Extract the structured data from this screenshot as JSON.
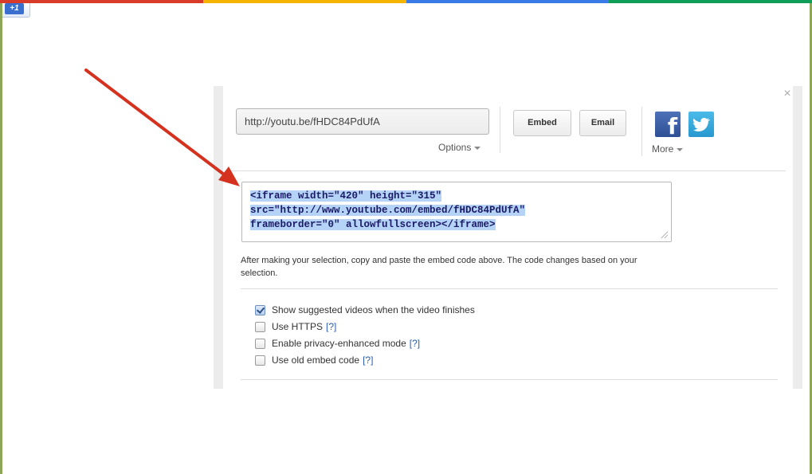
{
  "share": {
    "url_value": "http://youtu.be/fHDC84PdUfA",
    "options_label": "Options",
    "embed_label": "Embed",
    "email_label": "Email",
    "more_label": "More",
    "close_symbol": "×",
    "social": [
      {
        "name": "facebook",
        "glyph": "f"
      },
      {
        "name": "twitter",
        "glyph": ""
      },
      {
        "name": "google-plus-one",
        "glyph": "+1"
      }
    ]
  },
  "embed": {
    "code_lines": [
      "<iframe width=\"420\" height=\"315\"",
      "src=\"http://www.youtube.com/embed/fHDC84PdUfA\"",
      "frameborder=\"0\" allowfullscreen></iframe>"
    ],
    "help_text": "After making your selection, copy and paste the embed code above. The code changes based on your selection."
  },
  "options": [
    {
      "label": "Show suggested videos when the video finishes",
      "checked": true,
      "help": ""
    },
    {
      "label": "Use HTTPS",
      "checked": false,
      "help": "[?]"
    },
    {
      "label": "Enable privacy-enhanced mode",
      "checked": false,
      "help": "[?]"
    },
    {
      "label": "Use old embed code",
      "checked": false,
      "help": "[?]"
    }
  ],
  "colors": {
    "frame_border": "#8da556",
    "annotation_arrow": "#d4321e",
    "selection_highlight": "#b5d3f7",
    "link": "#2a5db0"
  }
}
